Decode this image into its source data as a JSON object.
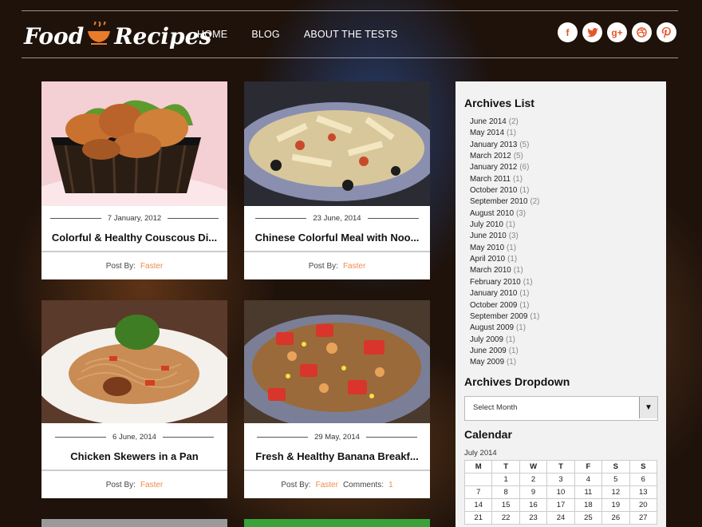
{
  "header": {
    "logo_text_1": "Food",
    "logo_text_2": "Recipes",
    "nav": [
      "HOME",
      "BLOG",
      "ABOUT THE TESTS"
    ],
    "social": [
      "f",
      "t",
      "g+",
      "d",
      "p"
    ]
  },
  "posts": [
    {
      "date": "7 January, 2012",
      "title": "Colorful & Healthy Couscous Di...",
      "post_by": "Post By:",
      "author": "Faster"
    },
    {
      "date": "23 June, 2014",
      "title": "Chinese Colorful Meal with Noo...",
      "post_by": "Post By:",
      "author": "Faster"
    },
    {
      "date": "6 June, 2014",
      "title": "Chicken Skewers in a Pan",
      "post_by": "Post By:",
      "author": "Faster"
    },
    {
      "date": "29 May, 2014",
      "title": "Fresh & Healthy Banana Breakf...",
      "post_by": "Post By:",
      "author": "Faster",
      "comments_label": "Comments:",
      "comments": "1"
    }
  ],
  "sidebar": {
    "archives_title": "Archives List",
    "archives": [
      {
        "month": "June 2014",
        "count": "(2)"
      },
      {
        "month": "May 2014",
        "count": "(1)"
      },
      {
        "month": "January 2013",
        "count": "(5)"
      },
      {
        "month": "March 2012",
        "count": "(5)"
      },
      {
        "month": "January 2012",
        "count": "(6)"
      },
      {
        "month": "March 2011",
        "count": "(1)"
      },
      {
        "month": "October 2010",
        "count": "(1)"
      },
      {
        "month": "September 2010",
        "count": "(2)"
      },
      {
        "month": "August 2010",
        "count": "(3)"
      },
      {
        "month": "July 2010",
        "count": "(1)"
      },
      {
        "month": "June 2010",
        "count": "(3)"
      },
      {
        "month": "May 2010",
        "count": "(1)"
      },
      {
        "month": "April 2010",
        "count": "(1)"
      },
      {
        "month": "March 2010",
        "count": "(1)"
      },
      {
        "month": "February 2010",
        "count": "(1)"
      },
      {
        "month": "January 2010",
        "count": "(1)"
      },
      {
        "month": "October 2009",
        "count": "(1)"
      },
      {
        "month": "September 2009",
        "count": "(1)"
      },
      {
        "month": "August 2009",
        "count": "(1)"
      },
      {
        "month": "July 2009",
        "count": "(1)"
      },
      {
        "month": "June 2009",
        "count": "(1)"
      },
      {
        "month": "May 2009",
        "count": "(1)"
      }
    ],
    "dropdown_title": "Archives Dropdown",
    "dropdown_value": "Select Month",
    "calendar_title": "Calendar",
    "calendar_caption": "July 2014",
    "calendar_days": [
      "M",
      "T",
      "W",
      "T",
      "F",
      "S",
      "S"
    ],
    "calendar_rows": [
      [
        "",
        "1",
        "2",
        "3",
        "4",
        "5",
        "6"
      ],
      [
        "7",
        "8",
        "9",
        "10",
        "11",
        "12",
        "13"
      ],
      [
        "14",
        "15",
        "16",
        "17",
        "18",
        "19",
        "20"
      ],
      [
        "21",
        "22",
        "23",
        "24",
        "25",
        "26",
        "27"
      ]
    ]
  },
  "colors": {
    "accent": "#f08a4b",
    "social_icon": "#e4572e"
  }
}
